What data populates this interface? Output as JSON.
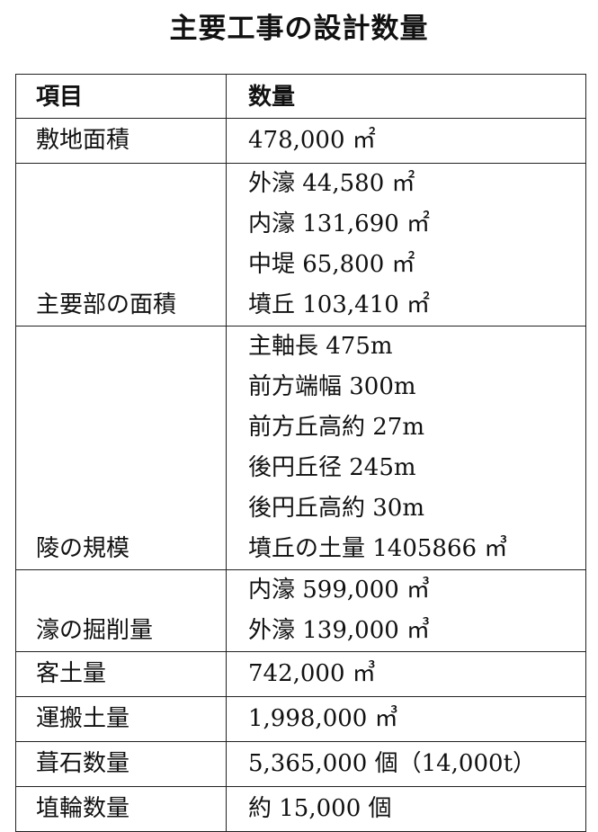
{
  "title": "主要工事の設計数量",
  "table": {
    "headers": [
      "項目",
      "数量"
    ],
    "rows": [
      {
        "item": "敷地面積",
        "values": [
          "478,000 ㎡"
        ]
      },
      {
        "item": "主要部の面積",
        "values": [
          "外濠 44,580 ㎡",
          "内濠 131,690 ㎡",
          "中堤 65,800 ㎡",
          "墳丘 103,410 ㎡"
        ]
      },
      {
        "item": "陵の規模",
        "values": [
          "主軸長 475m",
          "前方端幅 300m",
          "前方丘高約 27m",
          "後円丘径 245m",
          "後円丘高約 30m",
          "墳丘の土量 1405866 ㎥"
        ]
      },
      {
        "item": "濠の掘削量",
        "values": [
          "内濠 599,000 ㎥",
          "外濠 139,000 ㎥"
        ]
      },
      {
        "item": "客土量",
        "values": [
          "742,000 ㎥"
        ]
      },
      {
        "item": "運搬土量",
        "values": [
          "1,998,000 ㎥"
        ]
      },
      {
        "item": "葺石数量",
        "values": [
          "5,365,000 個（14,000t）"
        ]
      },
      {
        "item": "埴輪数量",
        "values": [
          "約 15,000 個"
        ]
      }
    ]
  }
}
